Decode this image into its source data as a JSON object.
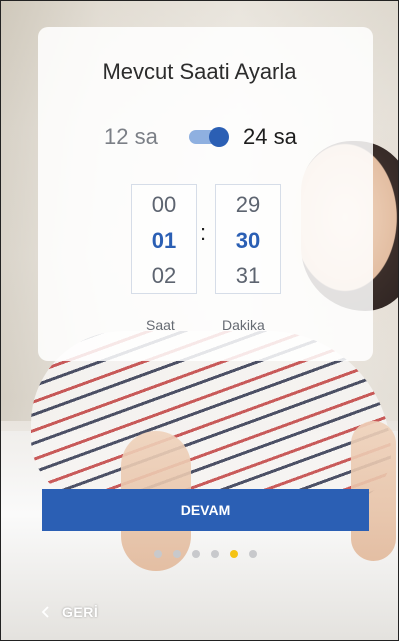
{
  "screen": {
    "title": "Mevcut Saati Ayarla"
  },
  "format": {
    "option_12": "12 sa",
    "option_24": "24 sa",
    "selected": "24 sa"
  },
  "picker": {
    "hours": [
      "00",
      "01",
      "02"
    ],
    "hours_selected": "01",
    "minutes": [
      "29",
      "30",
      "31"
    ],
    "minutes_selected": "30",
    "separator": ":",
    "hours_label": "Saat",
    "minutes_label": "Dakika"
  },
  "actions": {
    "continue_label": "DEVAM",
    "back_label": "GERİ"
  },
  "pagination": {
    "total": 6,
    "current": 5
  },
  "colors": {
    "accent": "#2b5fb4",
    "active_dot": "#f5c314"
  },
  "icons": {
    "back": "chevron-left-icon"
  }
}
